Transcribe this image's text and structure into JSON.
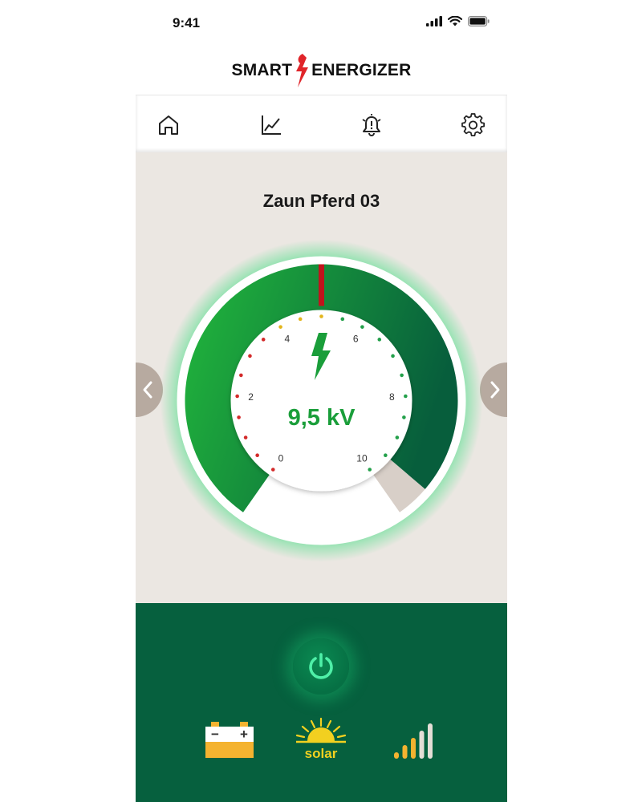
{
  "status_bar": {
    "time": "9:41",
    "icons": [
      "cellular-signal-icon",
      "wifi-icon",
      "battery-icon"
    ]
  },
  "brand": {
    "left": "SMART",
    "right": "ENERGIZER",
    "logo_icon": "lightning-bolt-icon",
    "accent_color": "#e0252a"
  },
  "nav": {
    "items": [
      {
        "name": "home",
        "icon": "home-icon"
      },
      {
        "name": "statistics",
        "icon": "chart-icon"
      },
      {
        "name": "alarms",
        "icon": "alarm-bell-icon"
      },
      {
        "name": "settings",
        "icon": "gear-icon"
      }
    ]
  },
  "device": {
    "name": "Zaun Pferd 03",
    "previous_icon": "chevron-left-icon",
    "next_icon": "chevron-right-icon"
  },
  "gauge": {
    "value_label": "9,5 kV",
    "value": 9.5,
    "scale_min": 0,
    "scale_max": 10,
    "scale_labels": [
      "0",
      "2",
      "4",
      "6",
      "8",
      "10"
    ],
    "center_icon": "lightning-bolt-icon",
    "colors": {
      "fill_start": "#22b83c",
      "fill_end": "#075e3c",
      "unused": "#d8cfc8",
      "marker": "#c0141c",
      "value_text": "#1a9e3a"
    }
  },
  "bottom_bar": {
    "power_icon": "power-icon",
    "battery_minus": "−",
    "battery_plus": "+",
    "solar_label": "solar",
    "icons": [
      "car-battery-icon",
      "solar-icon",
      "signal-strength-icon"
    ],
    "signal_bars_active": 3,
    "signal_bars_total": 5,
    "colors": {
      "background": "#06603e",
      "battery": "#f4b330",
      "solar": "#f2d020"
    }
  }
}
